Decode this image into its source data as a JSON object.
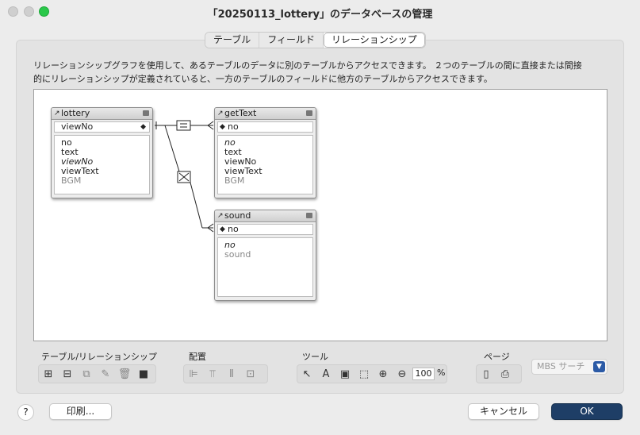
{
  "window": {
    "title": "「20250113_lottery」のデータベースの管理"
  },
  "tabs": [
    {
      "label": "テーブル",
      "active": false
    },
    {
      "label": "フィールド",
      "active": false
    },
    {
      "label": "リレーションシップ",
      "active": true
    }
  ],
  "description": {
    "line1": "リレーションシップグラフを使用して、あるテーブルのデータに別のテーブルからアクセスできます。 ２つのテーブルの間に直接または間接",
    "line2": "的にリレーションシップが定義されていると、一方のテーブルのフィールドに他方のテーブルからアクセスできます。"
  },
  "graph": {
    "tables": {
      "lottery": {
        "name": "lottery",
        "key": "viewNo",
        "fields": [
          "no",
          "text",
          "viewNo",
          "viewText",
          "BGM"
        ]
      },
      "getText": {
        "name": "getText",
        "key": "no",
        "fields": [
          "no",
          "text",
          "viewNo",
          "viewText",
          "BGM"
        ]
      },
      "sound": {
        "name": "sound",
        "key": "no",
        "fields": [
          "no",
          "sound"
        ]
      }
    },
    "relationships": [
      {
        "from": "lottery.viewNo",
        "to": "getText.no",
        "operator": "="
      },
      {
        "from": "lottery.viewNo",
        "to": "sound.no",
        "operator": "×"
      }
    ]
  },
  "toolbar": {
    "table_rel_label": "テーブル/リレーションシップ",
    "arrange_label": "配置",
    "tools_label": "ツール",
    "zoom_value": "100",
    "zoom_unit": "%",
    "page_label": "ページ",
    "plugin_select": "MBS サーチ"
  },
  "buttons": {
    "help": "?",
    "print": "印刷...",
    "cancel": "キャンセル",
    "ok": "OK"
  },
  "colors": {
    "ok_button": "#1e3e66",
    "canvas": "#ffffff",
    "window_bg": "#ececec"
  }
}
